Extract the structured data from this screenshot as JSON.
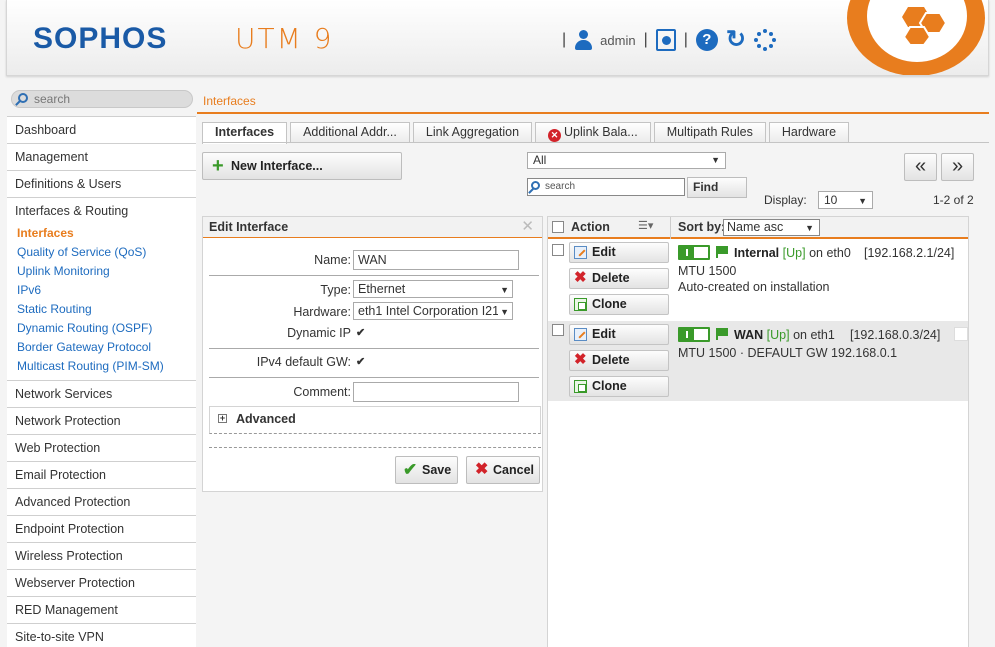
{
  "header": {
    "logo": "SOPHOS",
    "product": "UTM 9",
    "user": "admin",
    "brand_color": "#e87d1e",
    "accent_color": "#1d6bbf",
    "icons": [
      "user-icon",
      "clipboard-icon",
      "help-icon",
      "refresh-icon",
      "activity-icon"
    ]
  },
  "search": {
    "placeholder": "search"
  },
  "breadcrumb": "Interfaces",
  "sidebar": {
    "items_before": [
      "Dashboard",
      "Management",
      "Definitions & Users"
    ],
    "open_section": {
      "label": "Interfaces & Routing",
      "children": [
        "Interfaces",
        "Quality of Service (QoS)",
        "Uplink Monitoring",
        "IPv6",
        "Static Routing",
        "Dynamic Routing (OSPF)",
        "Border Gateway Protocol",
        "Multicast Routing (PIM-SM)"
      ],
      "active": "Interfaces"
    },
    "items_after": [
      "Network Services",
      "Network Protection",
      "Web Protection",
      "Email Protection",
      "Advanced Protection",
      "Endpoint Protection",
      "Wireless Protection",
      "Webserver Protection",
      "RED Management",
      "Site-to-site VPN"
    ]
  },
  "tabs": [
    "Interfaces",
    "Additional Addr...",
    "Link Aggregation",
    "Uplink Bala...",
    "Multipath Rules",
    "Hardware"
  ],
  "active_tab": "Interfaces",
  "toolbar": {
    "new_label": "New Interface...",
    "filter_value": "All",
    "find_placeholder": "search",
    "find_label": "Find",
    "prev_label": "«",
    "next_label": "»",
    "display_label": "Display:",
    "display_value": "10",
    "page_count": "1-2 of 2"
  },
  "edit": {
    "title": "Edit Interface",
    "name_label": "Name:",
    "name_value": "WAN",
    "type_label": "Type:",
    "type_value": "Ethernet",
    "hardware_label": "Hardware:",
    "hardware_value": "eth1 Intel Corporation I21",
    "dynamic_ip_label": "Dynamic IP",
    "dynamic_ip_checked": "✔",
    "gw_label": "IPv4 default GW:",
    "gw_checked": "✔",
    "comment_label": "Comment:",
    "comment_value": "",
    "advanced_label": "Advanced",
    "save_label": "Save",
    "cancel_label": "Cancel"
  },
  "list": {
    "action_header": "Action",
    "sort_label": "Sort by:",
    "sort_value": "Name asc",
    "edit_label": "Edit",
    "delete_label": "Delete",
    "clone_label": "Clone",
    "rows": [
      {
        "name": "Internal",
        "status": "[Up]",
        "on": "on eth0",
        "addr": "[192.168.2.1/24]",
        "line1": "MTU 1500",
        "line2": "Auto-created on installation"
      },
      {
        "name": "WAN",
        "status": "[Up]",
        "on": "on eth1",
        "addr": "[192.168.0.3/24]",
        "line1": "MTU 1500 · DEFAULT GW 192.168.0.1",
        "line2": ""
      }
    ]
  }
}
